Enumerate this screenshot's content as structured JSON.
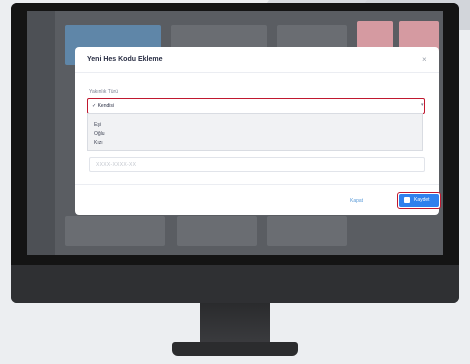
{
  "modal": {
    "title": "Yeni Hes Kodu Ekleme",
    "close_symbol": "×",
    "field_label": "Yakınlık Türü",
    "selected_value": "✓ Kendisi",
    "options": [
      "✓ Kendisi",
      "Eşi",
      "Oğlu",
      "Kızı"
    ],
    "input_placeholder": "XXXX-XXXX-XX",
    "cancel_label": "Kapat",
    "save_label": "Kaydet"
  },
  "colors": {
    "highlight": "#c0182f",
    "primary": "#2f80ed",
    "screen_bg": "#5a5d62"
  },
  "icons": {
    "close": "close-icon",
    "save": "floppy-disk-icon",
    "dropdown": "chevron-down-icon"
  }
}
